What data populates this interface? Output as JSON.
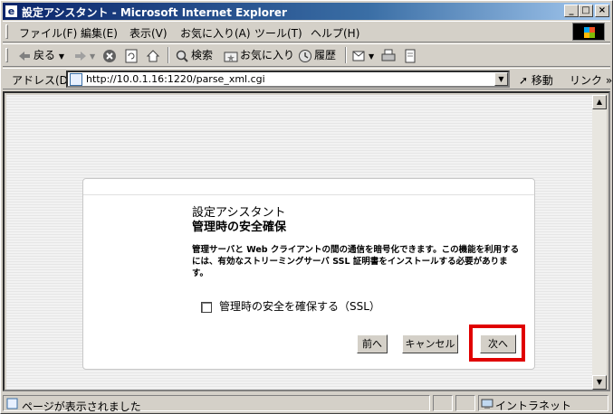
{
  "window": {
    "title": "設定アシスタント - Microsoft Internet Explorer",
    "icon": "ie-page-icon",
    "minimize": "_",
    "maximize": "□",
    "close": "×"
  },
  "menu": {
    "items": [
      "ファイル(F)",
      "編集(E)",
      "表示(V)",
      "お気に入り(A)",
      "ツール(T)",
      "ヘルプ(H)"
    ]
  },
  "toolbar": {
    "back": "戻る",
    "search": "検索",
    "favorites": "お気に入り",
    "history": "履歴"
  },
  "address": {
    "label": "アドレス(D)",
    "url": "http://10.0.1.16:1220/parse_xml.cgi",
    "go": "移動",
    "links": "リンク"
  },
  "dialog": {
    "title": "設定アシスタント",
    "subtitle": "管理時の安全確保",
    "description": "管理サーバと Web クライアントの間の通信を暗号化できます。この機能を利用するには、有効なストリーミングサーバ SSL 証明書をインストールする必要があります。",
    "checkbox_label": "管理時の安全を確保する（SSL）",
    "checkbox_checked": false,
    "buttons": {
      "prev": "前へ",
      "cancel": "キャンセル",
      "next": "次へ"
    },
    "highlight_color": "#e00000"
  },
  "status": {
    "text": "ページが表示されました",
    "zone": "イントラネット"
  }
}
